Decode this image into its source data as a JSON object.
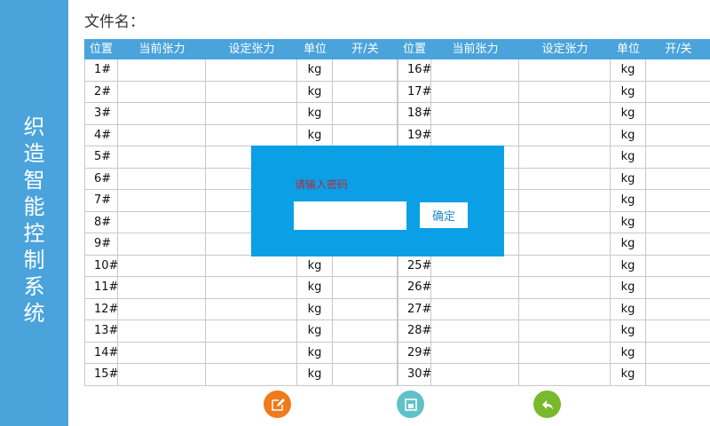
{
  "sidebar": {
    "title_chars": [
      "织",
      "造",
      "智",
      "能",
      "控",
      "制",
      "系",
      "统"
    ]
  },
  "file": {
    "label": "文件名："
  },
  "table": {
    "headers": [
      "位置",
      "当前张力",
      "设定张力",
      "单位",
      "开/关"
    ],
    "left_rows": [
      {
        "pos": "1#",
        "unit": "kg"
      },
      {
        "pos": "2#",
        "unit": "kg"
      },
      {
        "pos": "3#",
        "unit": "kg"
      },
      {
        "pos": "4#",
        "unit": "kg"
      },
      {
        "pos": "5#",
        "unit": ""
      },
      {
        "pos": "6#",
        "unit": ""
      },
      {
        "pos": "7#",
        "unit": ""
      },
      {
        "pos": "8#",
        "unit": ""
      },
      {
        "pos": "9#",
        "unit": ""
      },
      {
        "pos": "10#",
        "unit": "kg"
      },
      {
        "pos": "11#",
        "unit": "kg"
      },
      {
        "pos": "12#",
        "unit": "kg"
      },
      {
        "pos": "13#",
        "unit": "kg"
      },
      {
        "pos": "14#",
        "unit": "kg"
      },
      {
        "pos": "15#",
        "unit": "kg"
      }
    ],
    "right_rows": [
      {
        "pos": "16#",
        "unit": "kg"
      },
      {
        "pos": "17#",
        "unit": "kg"
      },
      {
        "pos": "18#",
        "unit": "kg"
      },
      {
        "pos": "19#",
        "unit": "kg"
      },
      {
        "pos": "",
        "unit": "kg"
      },
      {
        "pos": "",
        "unit": "kg"
      },
      {
        "pos": "",
        "unit": "kg"
      },
      {
        "pos": "",
        "unit": "kg"
      },
      {
        "pos": "",
        "unit": "kg"
      },
      {
        "pos": "25#",
        "unit": "kg"
      },
      {
        "pos": "26#",
        "unit": "kg"
      },
      {
        "pos": "27#",
        "unit": "kg"
      },
      {
        "pos": "28#",
        "unit": "kg"
      },
      {
        "pos": "29#",
        "unit": "kg"
      },
      {
        "pos": "30#",
        "unit": "kg"
      }
    ]
  },
  "modal": {
    "prompt": "请输入密码",
    "password_value": "",
    "confirm_label": "确定"
  },
  "footer": {
    "buttons": [
      {
        "icon": "edit-icon",
        "color": "#f07a1c"
      },
      {
        "icon": "save-icon",
        "color": "#5fc2c8"
      },
      {
        "icon": "back-icon",
        "color": "#7ab82e"
      }
    ]
  },
  "colors": {
    "accent": "#4aa3db",
    "modal_bg": "#0ba0e6",
    "prompt_text": "#b5293b"
  }
}
